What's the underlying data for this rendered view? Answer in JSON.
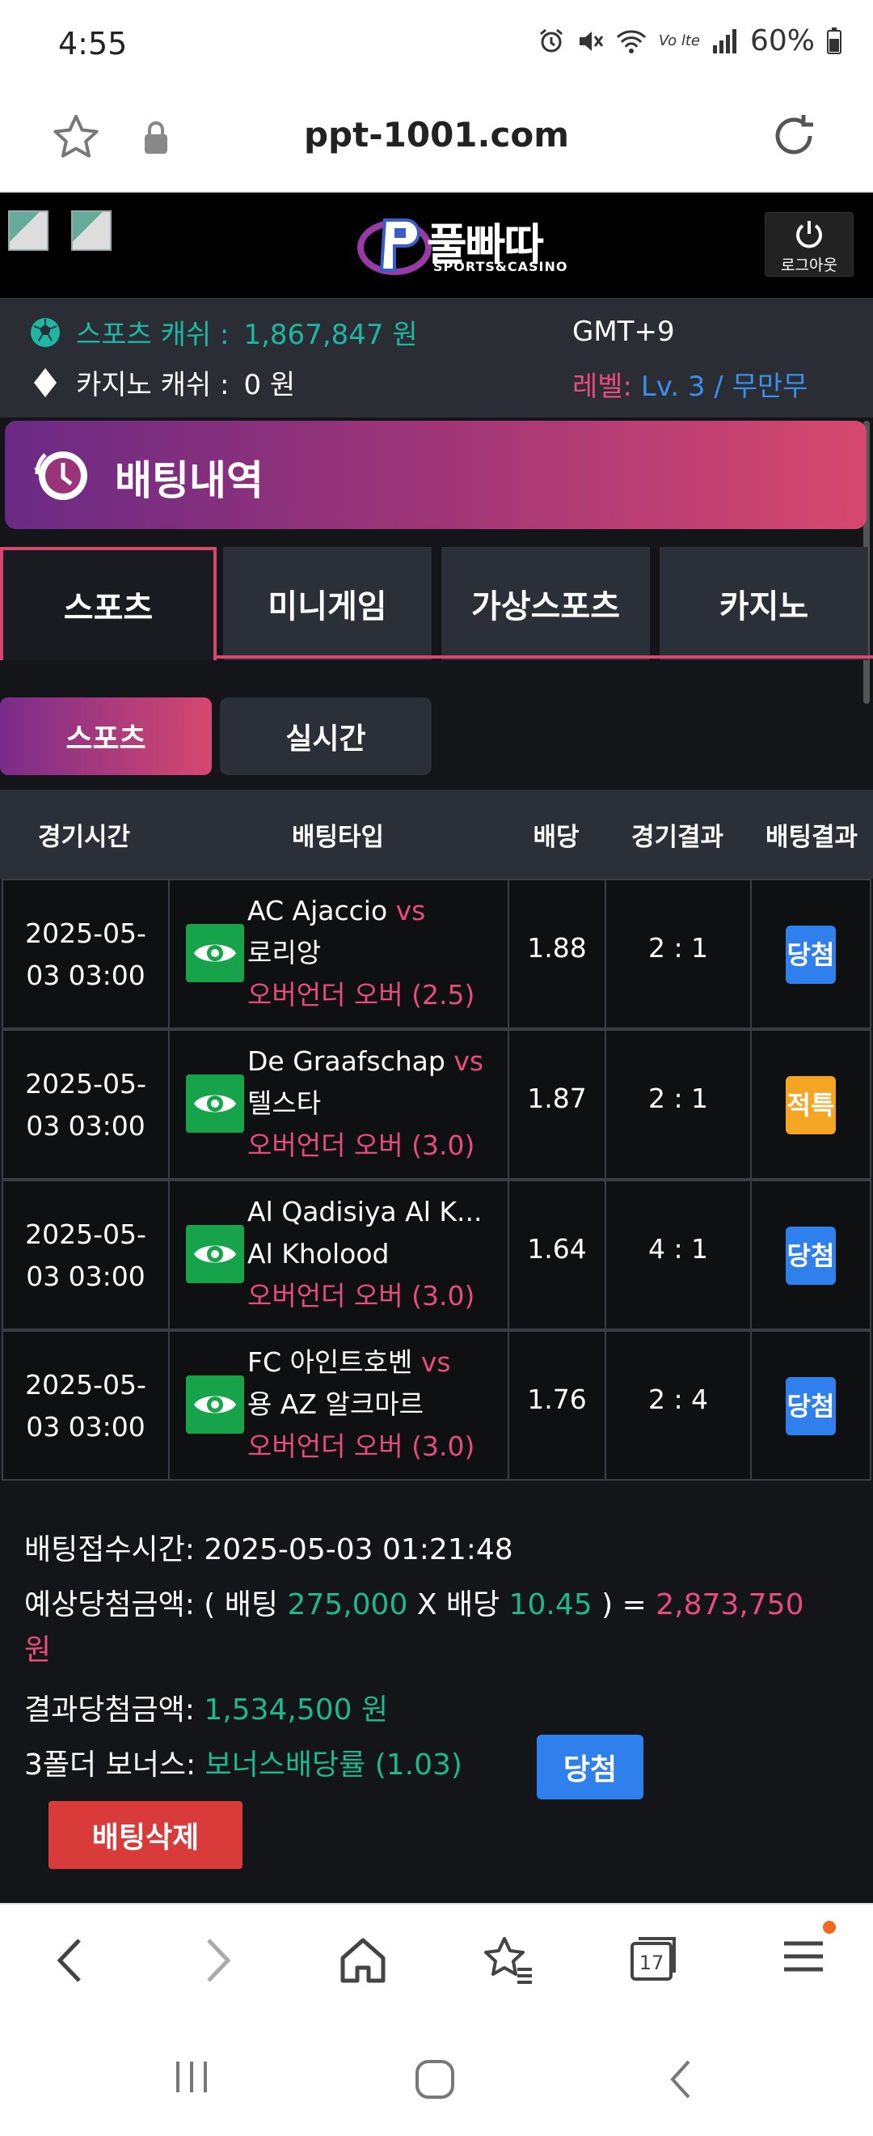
{
  "status_bar": {
    "time": "4:55",
    "battery": "60%"
  },
  "browser": {
    "url": "ppt-1001.com",
    "tabs_count": "17"
  },
  "header": {
    "logo_text": "풀빠따",
    "logo_sub": "SPORTS&CASINO",
    "logout_label": "로그아웃"
  },
  "account": {
    "sports_cash_label": "스포츠 캐쉬 :",
    "sports_cash_value": "1,867,847 원",
    "casino_cash_label": "카지노 캐쉬 :",
    "casino_cash_value": "0 원",
    "timezone": "GMT+9",
    "level_label": "레벨:",
    "level_value": "Lv. 3 / 무만무"
  },
  "page_title": "배팅내역",
  "main_tabs": [
    {
      "label": "스포츠",
      "active": true
    },
    {
      "label": "미니게임",
      "active": false
    },
    {
      "label": "가상스포츠",
      "active": false
    },
    {
      "label": "카지노",
      "active": false
    }
  ],
  "sub_tabs": [
    {
      "label": "스포츠",
      "active": true
    },
    {
      "label": "실시간",
      "active": false
    }
  ],
  "table": {
    "headers": [
      "경기시간",
      "배팅타입",
      "배당",
      "경기결과",
      "배팅결과"
    ],
    "rows": [
      {
        "date": "2025-05-",
        "time": "03 03:00",
        "home": "AC Ajaccio",
        "vs": "vs",
        "away": "로리앙",
        "bet_type": "오버언더 오버 (2.5)",
        "odds": "1.88",
        "score": "2 : 1",
        "result": "당첨",
        "result_kind": "win"
      },
      {
        "date": "2025-05-",
        "time": "03 03:00",
        "home": "De Graafschap",
        "vs": "vs",
        "away": "텔스타",
        "bet_type": "오버언더 오버 (3.0)",
        "odds": "1.87",
        "score": "2 : 1",
        "result": "적특",
        "result_kind": "refund"
      },
      {
        "date": "2025-05-",
        "time": "03 03:00",
        "home": "Al Qadisiya Al K...",
        "vs": "",
        "away": "Al Kholood",
        "bet_type": "오버언더 오버 (3.0)",
        "odds": "1.64",
        "score": "4 : 1",
        "result": "당첨",
        "result_kind": "win"
      },
      {
        "date": "2025-05-",
        "time": "03 03:00",
        "home": "FC 아인트호벤",
        "vs": "vs",
        "away": "용 AZ 알크마르",
        "bet_type": "오버언더 오버 (3.0)",
        "odds": "1.76",
        "score": "2 : 4",
        "result": "당첨",
        "result_kind": "win"
      }
    ]
  },
  "summary": {
    "received_label": "배팅접수시간:",
    "received_value": "2025-05-03 01:21:48",
    "expected_label": "예상당첨금액: ( 배팅",
    "bet_amount": "275,000",
    "x_label": "X 배당",
    "total_odds": "10.45",
    "eq_label": ") =",
    "expected_value": "2,873,750",
    "won_unit": "원",
    "result_label": "결과당첨금액:",
    "result_value": "1,534,500 원",
    "bonus_label": "3폴더 보너스:",
    "bonus_value": "보너스배당률 (1.03)",
    "bonus_status": "당첨",
    "delete_label": "배팅삭제"
  },
  "colors": {
    "accent_pink": "#d6486e",
    "accent_purple": "#7a2c8a",
    "green": "#1fb78f",
    "blue": "#2f80ed",
    "orange": "#f5a524",
    "red": "#d93a3a"
  }
}
